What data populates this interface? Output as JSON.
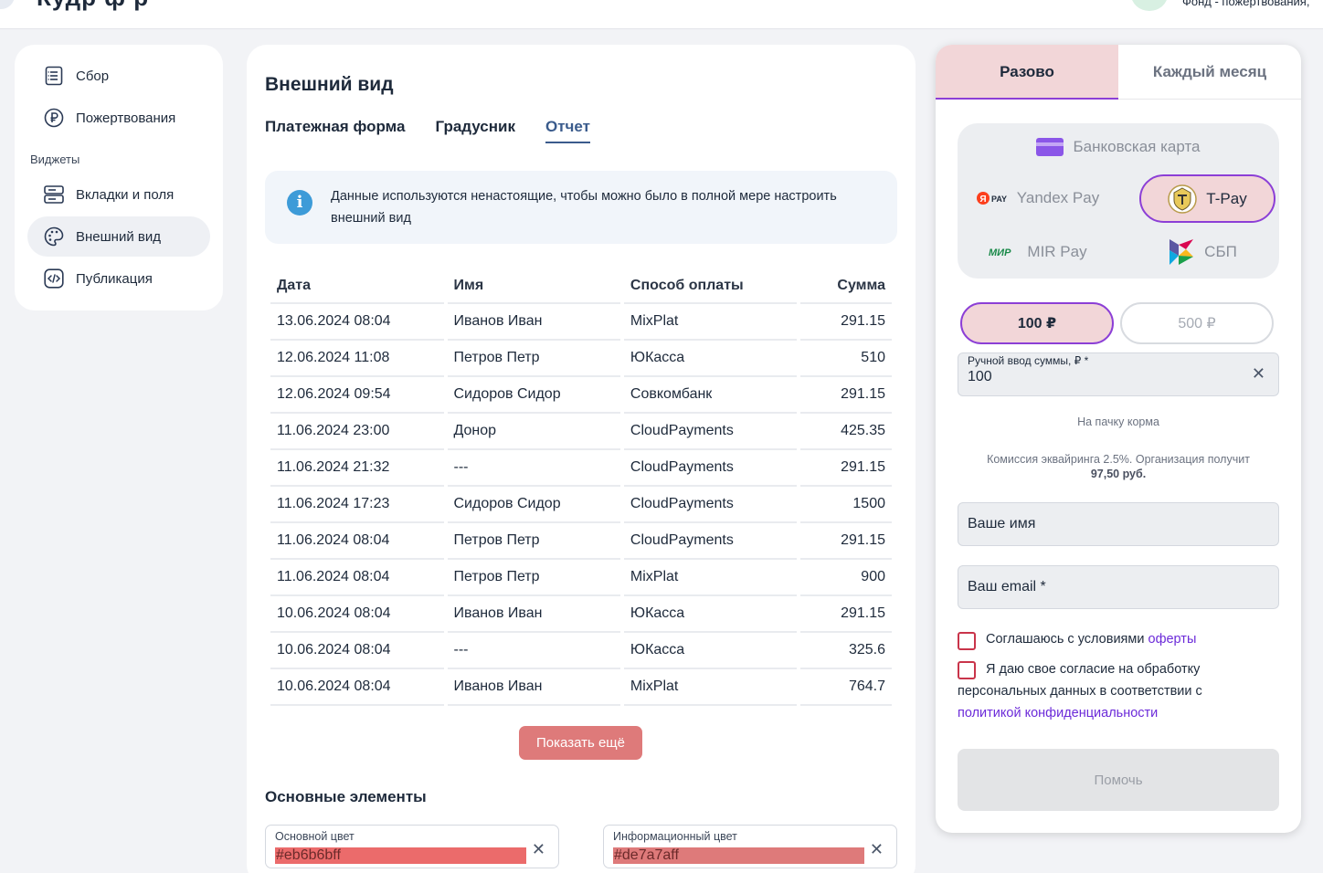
{
  "topbar": {
    "title": "Кудр  ф   р",
    "org": "Фонд - пожертвования,"
  },
  "sidebar": {
    "items": [
      {
        "label": "Сбор",
        "icon": "list-doc-icon"
      },
      {
        "label": "Пожертвования",
        "icon": "ruble-icon"
      }
    ],
    "section": "Виджеты",
    "widget_items": [
      {
        "label": "Вкладки и поля",
        "icon": "tabs-fields-icon"
      },
      {
        "label": "Внешний вид",
        "icon": "palette-icon",
        "active": true
      },
      {
        "label": "Публикация",
        "icon": "code-icon"
      }
    ]
  },
  "main": {
    "title": "Внешний вид",
    "tabs": [
      {
        "label": "Платежная форма"
      },
      {
        "label": "Градусник"
      },
      {
        "label": "Отчет",
        "active": true
      }
    ],
    "info": {
      "icon": "info-icon",
      "text": "Данные используются ненастоящие, чтобы можно было в полной мере настроить внешний вид"
    },
    "table": {
      "headers": [
        "Дата",
        "Имя",
        "Способ оплаты",
        "Сумма"
      ],
      "rows": [
        [
          "13.06.2024 08:04",
          "Иванов Иван",
          "MixPlat",
          "291.15"
        ],
        [
          "12.06.2024 11:08",
          "Петров Петр",
          "ЮКасса",
          "510"
        ],
        [
          "12.06.2024 09:54",
          "Сидоров Сидор",
          "Совкомбанк",
          "291.15"
        ],
        [
          "11.06.2024 23:00",
          "Донор",
          "CloudPayments",
          "425.35"
        ],
        [
          "11.06.2024 21:32",
          "---",
          "CloudPayments",
          "291.15"
        ],
        [
          "11.06.2024 17:23",
          "Сидоров Сидор",
          "CloudPayments",
          "1500"
        ],
        [
          "11.06.2024 08:04",
          "Петров Петр",
          "CloudPayments",
          "291.15"
        ],
        [
          "11.06.2024 08:04",
          "Петров Петр",
          "MixPlat",
          "900"
        ],
        [
          "10.06.2024 08:04",
          "Иванов Иван",
          "ЮКасса",
          "291.15"
        ],
        [
          "10.06.2024 08:04",
          "---",
          "ЮКасса",
          "325.6"
        ],
        [
          "10.06.2024 08:04",
          "Иванов Иван",
          "MixPlat",
          "764.7"
        ]
      ]
    },
    "more_button": "Показать ещё",
    "section_title": "Основные элементы",
    "colors": [
      {
        "label": "Основной цвет",
        "value": "#eb6b6bff",
        "swatch": "#eb6b6b"
      },
      {
        "label": "Информационный цвет",
        "value": "#de7a7aff",
        "swatch": "#de7a7a"
      }
    ]
  },
  "widget": {
    "tabs": [
      {
        "label": "Разово",
        "active": true
      },
      {
        "label": "Каждый месяц"
      }
    ],
    "methods": {
      "card": "Банковская карта",
      "yandex": "Yandex Pay",
      "yandex_badge": "PAY",
      "tpay": "T-Pay",
      "mir": "MIR Pay",
      "mir_badge": "МИР",
      "sbp": "СБП"
    },
    "amounts": [
      "100 ₽",
      "500 ₽"
    ],
    "manual": {
      "label": "Ручной ввод суммы, ₽ *",
      "value": "100"
    },
    "purpose": "На пачку корма",
    "fee_text": "Комиссия эквайринга 2.5%. Организация получит",
    "fee_amount": "97,50 руб.",
    "name_placeholder": "Ваше имя",
    "email_placeholder": "Ваш email *",
    "agree_offer_text": "Соглашаюсь с условиями ",
    "agree_offer_link": "оферты",
    "agree_pd_text": "Я даю свое согласие на обработку персональных данных в соответствии с ",
    "agree_pd_link": "политикой конфиденциальности",
    "help_button": "Помочь"
  },
  "accent_colors": {
    "primary": "#eb6b6b",
    "info": "#de7a7a",
    "selected_bg": "#f2d6d8",
    "selected_border": "#8c3fd6",
    "link": "#6c2bd9"
  }
}
